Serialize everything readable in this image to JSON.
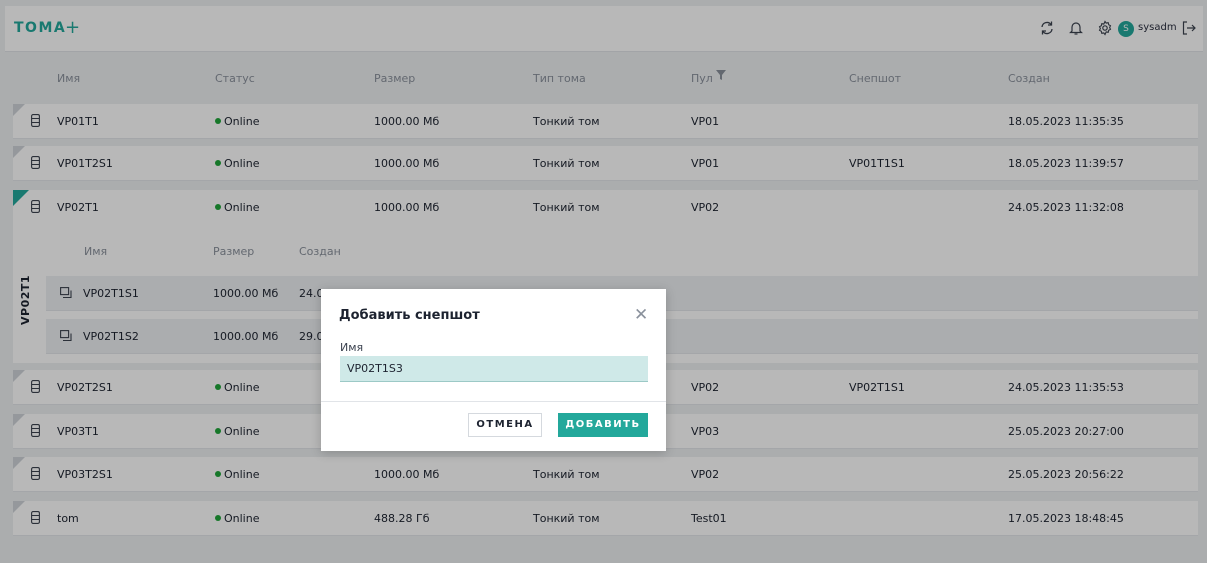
{
  "header": {
    "title": "ТОМА",
    "add_label": "+",
    "username": "sysadm",
    "avatar_letter": "S"
  },
  "columns": [
    "Имя",
    "Статус",
    "Размер",
    "Тип тома",
    "Пул",
    "Снепшот",
    "Создан"
  ],
  "volumes": [
    {
      "name": "VP01T1",
      "status": "Online",
      "size": "1000.00 Мб",
      "type": "Тонкий том",
      "pool": "VP01",
      "snapshot": "",
      "created": "18.05.2023 11:35:35"
    },
    {
      "name": "VP01T2S1",
      "status": "Online",
      "size": "1000.00 Мб",
      "type": "Тонкий том",
      "pool": "VP01",
      "snapshot": "VP01T1S1",
      "created": "18.05.2023 11:39:57"
    },
    {
      "name": "VP02T1",
      "status": "Online",
      "size": "1000.00 Мб",
      "type": "Тонкий том",
      "pool": "VP02",
      "snapshot": "",
      "created": "24.05.2023 11:32:08"
    },
    {
      "name": "VP02T2S1",
      "status": "Online",
      "size": "",
      "type": "",
      "pool": "VP02",
      "snapshot": "VP02T1S1",
      "created": "24.05.2023 11:35:53"
    },
    {
      "name": "VP03T1",
      "status": "Online",
      "size": "",
      "type": "",
      "pool": "VP03",
      "snapshot": "",
      "created": "25.05.2023 20:27:00"
    },
    {
      "name": "VP03T2S1",
      "status": "Online",
      "size": "1000.00 Мб",
      "type": "Тонкий том",
      "pool": "VP02",
      "snapshot": "",
      "created": "25.05.2023 20:56:22"
    },
    {
      "name": "tom",
      "status": "Online",
      "size": "488.28 Гб",
      "type": "Тонкий том",
      "pool": "Test01",
      "snapshot": "",
      "created": "17.05.2023 18:48:45"
    }
  ],
  "expanded": {
    "label": "VP02T1",
    "columns": [
      "Имя",
      "Размер",
      "Создан"
    ],
    "snapshots": [
      {
        "name": "VP02T1S1",
        "size": "1000.00 Мб",
        "created": "24.0"
      },
      {
        "name": "VP02T1S2",
        "size": "1000.00 Мб",
        "created": "29.0"
      }
    ]
  },
  "modal": {
    "title": "Добавить снепшот",
    "field_label": "Имя",
    "field_value": "VP02T1S3",
    "cancel_label": "ОТМЕНА",
    "submit_label": "ДОБАВИТЬ"
  },
  "colors": {
    "accent": "#23a89b",
    "online": "#1fa53a"
  },
  "icons": [
    "refresh-icon",
    "bell-icon",
    "settings-icon",
    "logout-icon",
    "database-icon",
    "snapshot-icon",
    "filter-icon",
    "close-icon"
  ]
}
